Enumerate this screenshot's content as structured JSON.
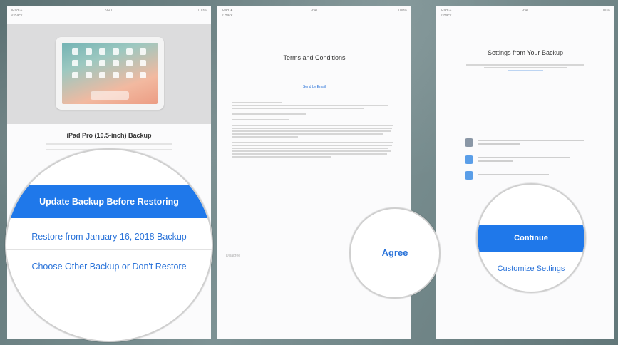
{
  "panel1": {
    "status_left": "iPad ✈",
    "status_center": "9:41",
    "status_right": "100%",
    "back": "< Back",
    "title": "iPad Pro (10.5-inch) Backup",
    "options": {
      "primary": "Update Backup Before Restoring",
      "restore": "Restore from January 16, 2018 Backup",
      "choose": "Choose Other Backup or Don't Restore"
    }
  },
  "panel2": {
    "status_left": "iPad ✈",
    "status_center": "9:41",
    "status_right": "100%",
    "back": "< Back",
    "title": "Terms and Conditions",
    "link": "Send by Email",
    "agree": "Agree",
    "footer": "Disagree"
  },
  "panel3": {
    "status_left": "iPad ✈",
    "status_center": "9:41",
    "status_right": "100%",
    "back": "< Back",
    "title": "Settings from Your Backup",
    "continue": "Continue",
    "customize": "Customize Settings"
  },
  "colors": {
    "accent": "#1f78ea",
    "link": "#2a73d9"
  },
  "icons": [
    "photos-icon",
    "twitter-icon",
    "siri-icon"
  ]
}
